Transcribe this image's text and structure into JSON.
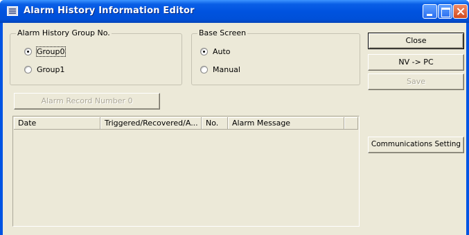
{
  "window": {
    "title": "Alarm History Information Editor"
  },
  "alarm_history_group": {
    "label": "Alarm History Group No.",
    "options": [
      {
        "label": "Group0",
        "selected": true
      },
      {
        "label": "Group1",
        "selected": false
      }
    ]
  },
  "base_screen": {
    "label": "Base Screen",
    "options": [
      {
        "label": "Auto",
        "selected": true
      },
      {
        "label": "Manual",
        "selected": false
      }
    ]
  },
  "alarm_record_button": {
    "label": "Alarm Record Number 0",
    "enabled": false
  },
  "buttons": {
    "close": "Close",
    "nv_to_pc": "NV -> PC",
    "save": "Save",
    "communications_setting": "Communications Setting"
  },
  "table": {
    "columns": [
      "Date",
      "Triggered/Recovered/A...",
      "No.",
      "Alarm Message",
      ""
    ],
    "rows": []
  }
}
